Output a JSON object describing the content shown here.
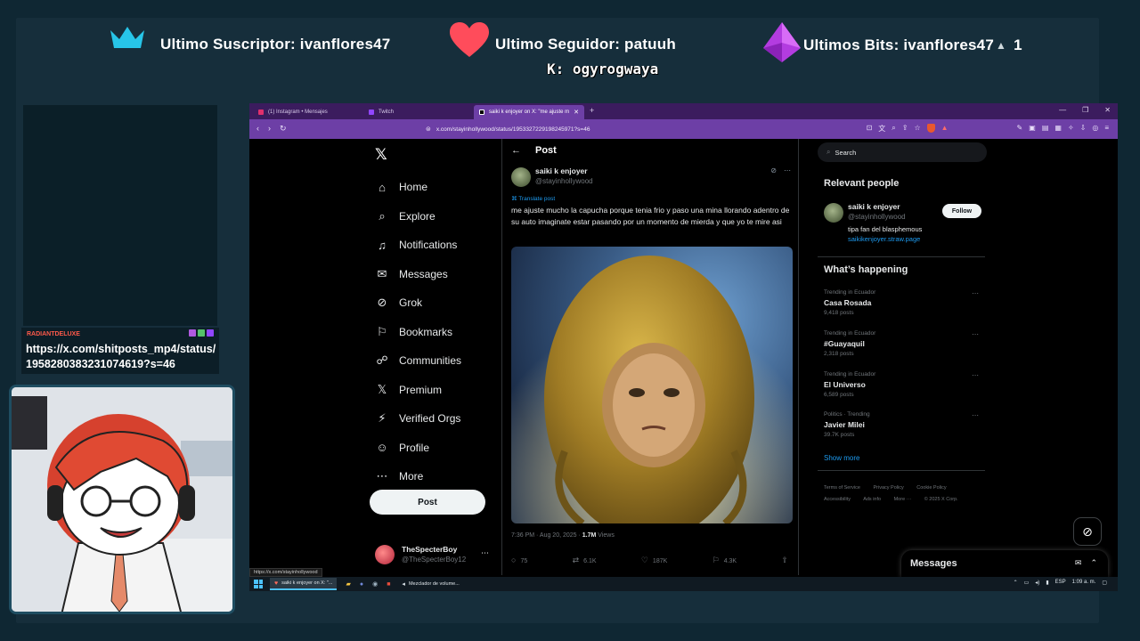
{
  "overlay": {
    "subscriber": "Ultimo Suscriptor: ivanflores47",
    "follower": "Ultimo Seguidor: patuuh",
    "bits": "Ultimos Bits: ivanflores47",
    "bits_count": "1",
    "ticker": "K: ogyrogwaya",
    "chat": {
      "user": "RADIANTDELUXE",
      "message": "https://x.com/shitposts_mp4/status/1958280383231074619?s=46"
    }
  },
  "browser": {
    "tabs": [
      {
        "label": "(1) Instagram • Mensajes"
      },
      {
        "label": "Twitch"
      },
      {
        "label": "saiki k enjoyer on X: \"me ajuste m"
      }
    ],
    "url": "x.com/stayinhollywood/status/1953327229198245971?s=46",
    "status_url": "https://x.com/stayinhollywood"
  },
  "x": {
    "nav": [
      {
        "icon": "home-icon",
        "label": "Home"
      },
      {
        "icon": "explore-icon",
        "label": "Explore"
      },
      {
        "icon": "notifications-icon",
        "label": "Notifications"
      },
      {
        "icon": "messages-icon",
        "label": "Messages"
      },
      {
        "icon": "grok-icon",
        "label": "Grok"
      },
      {
        "icon": "bookmarks-icon",
        "label": "Bookmarks"
      },
      {
        "icon": "communities-icon",
        "label": "Communities"
      },
      {
        "icon": "premium-icon",
        "label": "Premium"
      },
      {
        "icon": "verified-orgs-icon",
        "label": "Verified Orgs"
      },
      {
        "icon": "profile-icon",
        "label": "Profile"
      },
      {
        "icon": "more-icon",
        "label": "More"
      }
    ],
    "post_button": "Post",
    "account": {
      "name": "TheSpecterBoy",
      "handle": "@TheSpecterBoy12"
    },
    "header_title": "Post",
    "post": {
      "author_name": "saiki k enjoyer",
      "author_handle": "@stayinhollywood",
      "translate": "Translate post",
      "text": "me ajuste mucho la capucha porque tenia frio y paso una mina llorando adentro de su auto imaginate estar pasando por un momento de mierda y que yo te mire asi",
      "time": "7:36 PM · Aug 20, 2025 · ",
      "views_count": "1.7M",
      "views_label": " Views",
      "replies": "75",
      "reposts": "6.1K",
      "likes": "187K",
      "bookmarks": "4.3K"
    },
    "search_placeholder": "Search",
    "relevant_title": "Relevant people",
    "relevant": {
      "name": "saiki k enjoyer",
      "handle": "@stayinhollywood",
      "bio": "tipa fan del blasphemous",
      "link": "saikikenjoyer.straw.page",
      "follow": "Follow"
    },
    "happening_title": "What’s happening",
    "trends": [
      {
        "context": "Trending in Ecuador",
        "name": "Casa Rosada",
        "count": "9,418 posts"
      },
      {
        "context": "Trending in Ecuador",
        "name": "#Guayaquil",
        "count": "2,318 posts"
      },
      {
        "context": "Trending in Ecuador",
        "name": "El Universo",
        "count": "6,589 posts"
      },
      {
        "context": "Politics · Trending",
        "name": "Javier Milei",
        "count": "39.7K posts"
      }
    ],
    "show_more": "Show more",
    "footer": [
      "Terms of Service",
      "Privacy Policy",
      "Cookie Policy",
      "Accessibility",
      "Ads info",
      "More ···",
      "© 2025 X Corp."
    ],
    "messages_drawer": "Messages"
  },
  "taskbar": {
    "items": [
      "saiki k enjoyer on X: \"...",
      "Mezclador de volume..."
    ],
    "lang": "ESP",
    "time": "1:09 a. m."
  },
  "colors": {
    "accent": "#1d9bf0",
    "browser_purple": "#6d3fa6",
    "overlay_bg": "#162e3b"
  }
}
